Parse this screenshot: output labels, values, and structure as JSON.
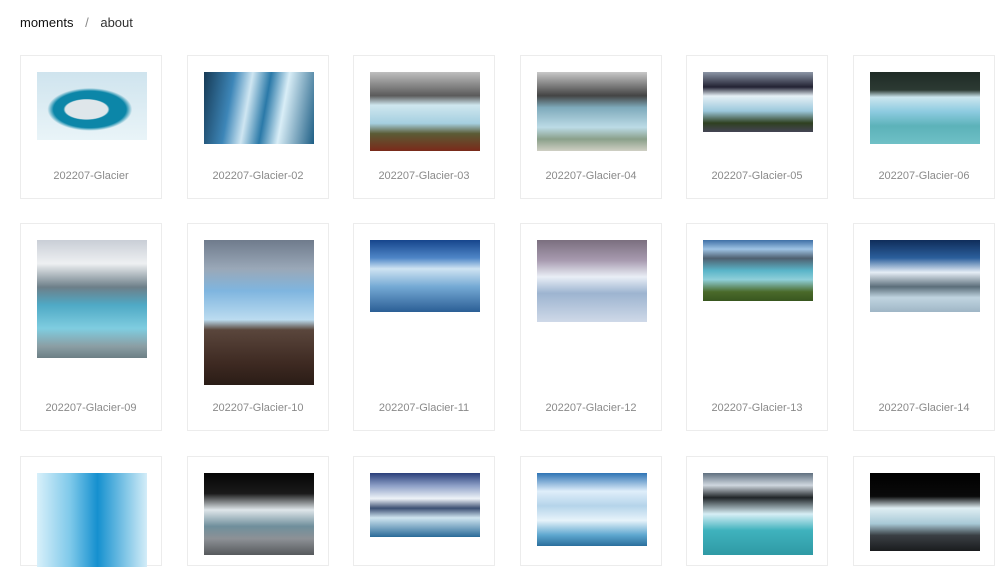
{
  "breadcrumb": {
    "home": "moments",
    "separator": "/",
    "current": "about"
  },
  "gallery": [
    {
      "caption": "202207-Glacier",
      "fill": "g-cave"
    },
    {
      "caption": "202207-Glacier-02",
      "fill": "g-blue"
    },
    {
      "caption": "202207-Glacier-03",
      "fill": "g-mtn"
    },
    {
      "caption": "202207-Glacier-04",
      "fill": "g-mtn2"
    },
    {
      "caption": "202207-Glacier-05",
      "fill": "g-5"
    },
    {
      "caption": "202207-Glacier-06",
      "fill": "g-6"
    },
    {
      "caption": "202207-Glacier-09",
      "fill": "g-9"
    },
    {
      "caption": "202207-Glacier-10",
      "fill": "g-10"
    },
    {
      "caption": "202207-Glacier-11",
      "fill": "g-11"
    },
    {
      "caption": "202207-Glacier-12",
      "fill": "g-12"
    },
    {
      "caption": "202207-Glacier-13",
      "fill": "g-13"
    },
    {
      "caption": "202207-Glacier-14",
      "fill": "g-14"
    },
    {
      "caption": "",
      "fill": "g-15"
    },
    {
      "caption": "",
      "fill": "g-16"
    },
    {
      "caption": "",
      "fill": "g-17"
    },
    {
      "caption": "",
      "fill": "g-18"
    },
    {
      "caption": "",
      "fill": "g-19"
    },
    {
      "caption": "",
      "fill": "g-20"
    }
  ]
}
